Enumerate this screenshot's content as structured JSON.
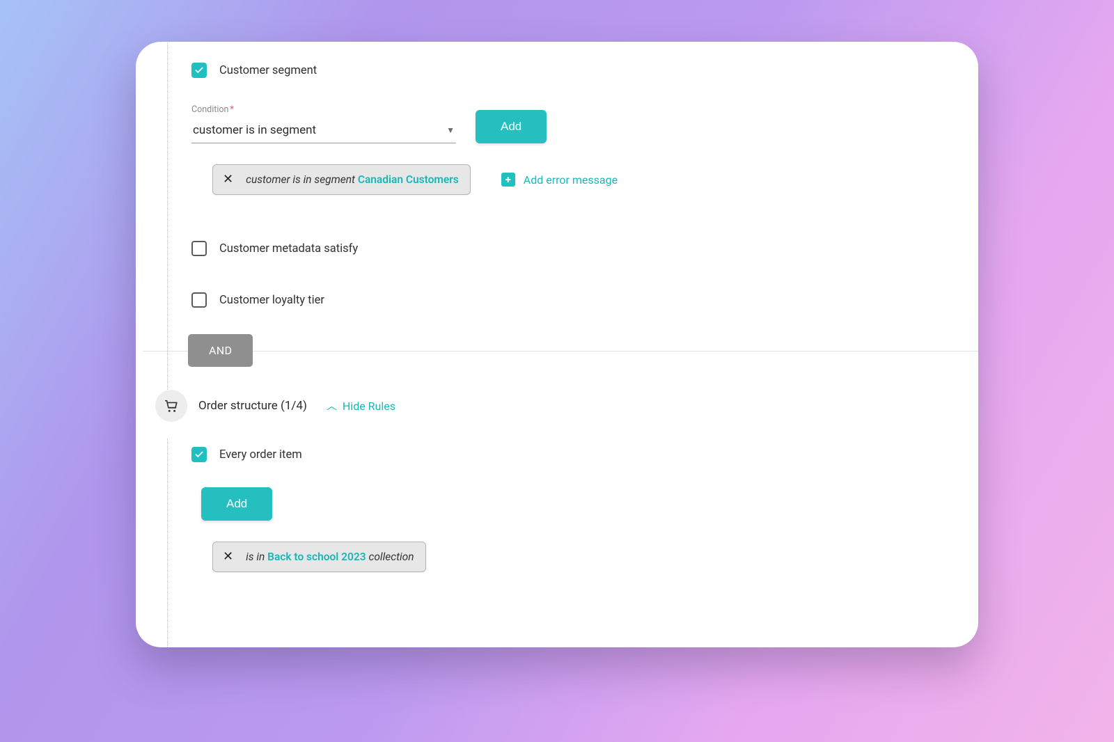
{
  "section1": {
    "rule1": {
      "label": "Customer segment",
      "checked": true
    },
    "condition": {
      "label": "Condition",
      "required_mark": "*",
      "select_value": "customer is in segment",
      "add_button": "Add"
    },
    "chip1": {
      "prefix": "customer is in segment",
      "value": "Canadian Customers"
    },
    "add_error_label": "Add error message",
    "rule2": {
      "label": "Customer metadata satisfy",
      "checked": false
    },
    "rule3": {
      "label": "Customer loyalty tier",
      "checked": false
    }
  },
  "and_label": "AND",
  "section2": {
    "title": "Order structure (1/4)",
    "hide_rules_label": "Hide Rules",
    "rule1": {
      "label": "Every order item",
      "checked": true
    },
    "add_button": "Add",
    "chip": {
      "prefix": "is in",
      "value": "Back to school 2023",
      "suffix": "collection"
    }
  }
}
